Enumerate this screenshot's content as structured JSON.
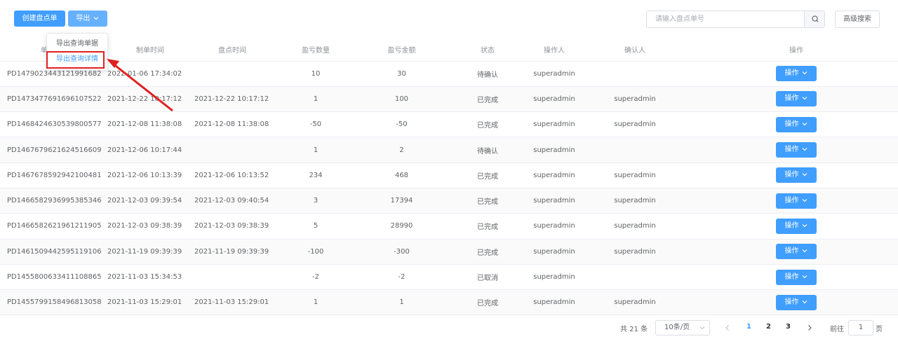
{
  "toolbar": {
    "create_label": "创建盘点单",
    "export_label": "导出",
    "search_placeholder": "请输入盘点单号",
    "advanced_label": "高级搜索"
  },
  "export_menu": {
    "items": [
      "导出查询单据",
      "导出查询详情"
    ]
  },
  "table": {
    "headers": [
      "单",
      "制单时间",
      "盘点时间",
      "盈亏数量",
      "盈亏金额",
      "状态",
      "操作人",
      "确认人",
      "操作"
    ],
    "action_label": "操作",
    "rows": [
      {
        "id": "PD1479023443121991682",
        "made": "2022-01-06 17:34:02",
        "counted": "",
        "qty": "10",
        "amount": "30",
        "status": "待确认",
        "operator": "superadmin",
        "confirmer": ""
      },
      {
        "id": "PD1473477691696107522",
        "made": "2021-12-22 10:17:12",
        "counted": "2021-12-22 10:17:12",
        "qty": "1",
        "amount": "100",
        "status": "已完成",
        "operator": "superadmin",
        "confirmer": "superadmin"
      },
      {
        "id": "PD1468424630539800577",
        "made": "2021-12-08 11:38:08",
        "counted": "2021-12-08 11:38:08",
        "qty": "-50",
        "amount": "-50",
        "status": "已完成",
        "operator": "superadmin",
        "confirmer": "superadmin"
      },
      {
        "id": "PD1467679621624516609",
        "made": "2021-12-06 10:17:44",
        "counted": "",
        "qty": "1",
        "amount": "2",
        "status": "待确认",
        "operator": "superadmin",
        "confirmer": ""
      },
      {
        "id": "PD1467678592942100481",
        "made": "2021-12-06 10:13:39",
        "counted": "2021-12-06 10:13:52",
        "qty": "234",
        "amount": "468",
        "status": "已完成",
        "operator": "superadmin",
        "confirmer": "superadmin"
      },
      {
        "id": "PD1466582936995385346",
        "made": "2021-12-03 09:39:54",
        "counted": "2021-12-03 09:40:54",
        "qty": "3",
        "amount": "17394",
        "status": "已完成",
        "operator": "superadmin",
        "confirmer": "superadmin"
      },
      {
        "id": "PD1466582621961211905",
        "made": "2021-12-03 09:38:39",
        "counted": "2021-12-03 09:38:39",
        "qty": "5",
        "amount": "28990",
        "status": "已完成",
        "operator": "superadmin",
        "confirmer": "superadmin"
      },
      {
        "id": "PD1461509442595119106",
        "made": "2021-11-19 09:39:39",
        "counted": "2021-11-19 09:39:39",
        "qty": "-100",
        "amount": "-300",
        "status": "已完成",
        "operator": "superadmin",
        "confirmer": "superadmin"
      },
      {
        "id": "PD1455800633411108865",
        "made": "2021-11-03 15:34:53",
        "counted": "",
        "qty": "-2",
        "amount": "-2",
        "status": "已取消",
        "operator": "superadmin",
        "confirmer": ""
      },
      {
        "id": "PD1455799158496813058",
        "made": "2021-11-03 15:29:01",
        "counted": "2021-11-03 15:29:01",
        "qty": "1",
        "amount": "1",
        "status": "已完成",
        "operator": "superadmin",
        "confirmer": "superadmin"
      }
    ]
  },
  "pagination": {
    "total_label": "共 21 条",
    "page_size": "10条/页",
    "pages": [
      "1",
      "2",
      "3"
    ],
    "current_page": "1",
    "goto_label": "前往",
    "goto_value": "1",
    "page_suffix": "页"
  },
  "colors": {
    "primary": "#409eff",
    "highlight": "#e02020"
  }
}
